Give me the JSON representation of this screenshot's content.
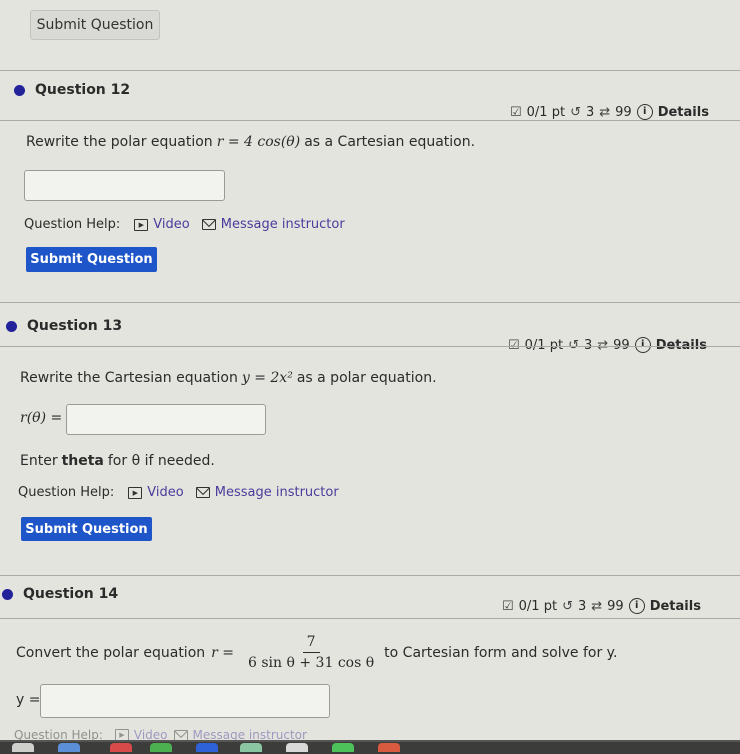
{
  "top": {
    "submit_label": "Submit Question"
  },
  "questions": [
    {
      "title": "Question 12",
      "score": "0/1 pt",
      "retries": "3",
      "attempts": "99",
      "details_label": "Details",
      "prompt_before": "Rewrite the polar equation",
      "math": "r = 4 cos(θ)",
      "prompt_after": "as a Cartesian equation.",
      "answer_value": "",
      "help_label": "Question Help:",
      "video_label": "Video",
      "message_label": "Message instructor",
      "submit_label": "Submit Question"
    },
    {
      "title": "Question 13",
      "score": "0/1 pt",
      "retries": "3",
      "attempts": "99",
      "details_label": "Details",
      "prompt_before": "Rewrite the Cartesian equation",
      "math": "y = 2x²",
      "prompt_after": "as a polar equation.",
      "answer_label": "r(θ) =",
      "answer_value": "",
      "hint_before": "Enter",
      "hint_bold": "theta",
      "hint_after": "for θ if needed.",
      "help_label": "Question Help:",
      "video_label": "Video",
      "message_label": "Message instructor",
      "submit_label": "Submit Question"
    },
    {
      "title": "Question 14",
      "score": "0/1 pt",
      "retries": "3",
      "attempts": "99",
      "details_label": "Details",
      "prompt_before": "Convert the polar equation",
      "math_lhs": "r =",
      "numerator": "7",
      "denominator": "6 sin θ + 31 cos θ",
      "prompt_after": "to Cartesian form and solve for y.",
      "answer_label": "y =",
      "answer_value": "",
      "help_label": "Question Help:",
      "video_label": "Video",
      "message_label": "Message instructor"
    }
  ],
  "icons": {
    "score": "☑",
    "retry": "↺",
    "attempts": "⇄",
    "info": "i",
    "video": "▶"
  }
}
